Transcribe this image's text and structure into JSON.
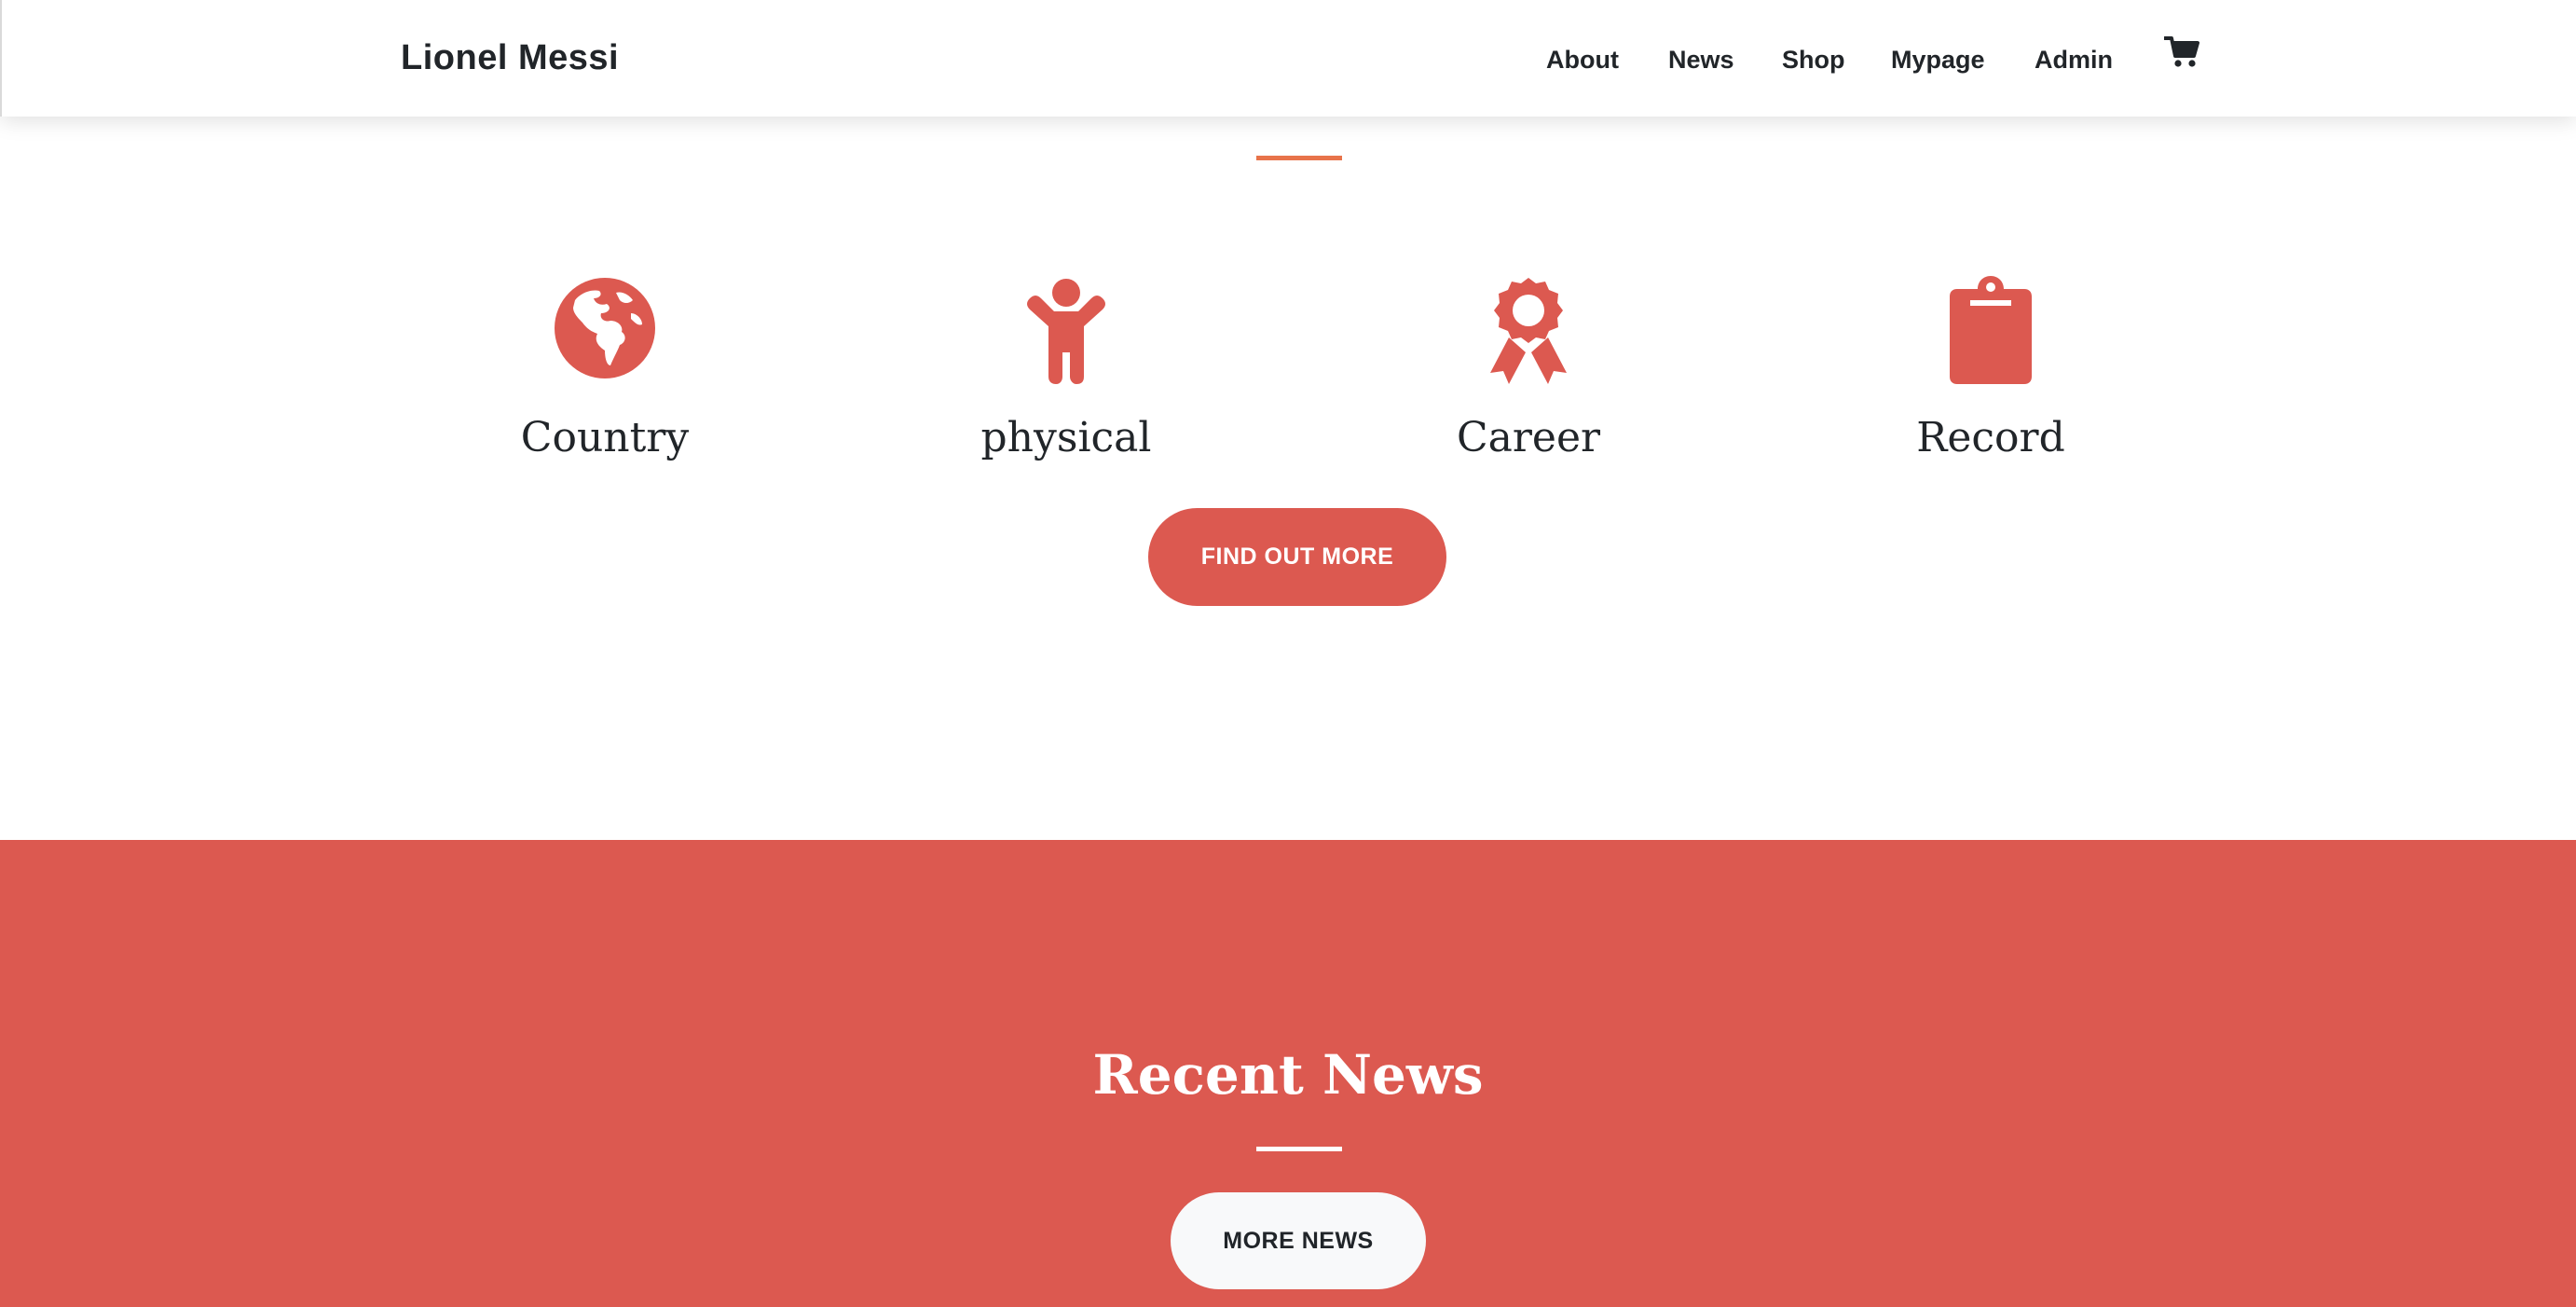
{
  "navbar": {
    "brand": "Lionel Messi",
    "links": [
      {
        "label": "About"
      },
      {
        "label": "News"
      },
      {
        "label": "Shop"
      },
      {
        "label": "Mypage"
      },
      {
        "label": "Admin"
      }
    ],
    "cart_icon": "shopping-cart-icon"
  },
  "services": {
    "items": [
      {
        "label": "Country",
        "icon": "globe-americas-icon"
      },
      {
        "label": "physical",
        "icon": "child-icon"
      },
      {
        "label": "Career",
        "icon": "award-icon"
      },
      {
        "label": "Record",
        "icon": "clipboard-icon"
      }
    ],
    "button_label": "FIND OUT MORE"
  },
  "news": {
    "title": "Recent News",
    "button_label": "MORE NEWS"
  },
  "colors": {
    "primary": "#dc5950",
    "accent_divider": "#e8734a",
    "text": "#212529",
    "light": "#f8f9fa"
  }
}
